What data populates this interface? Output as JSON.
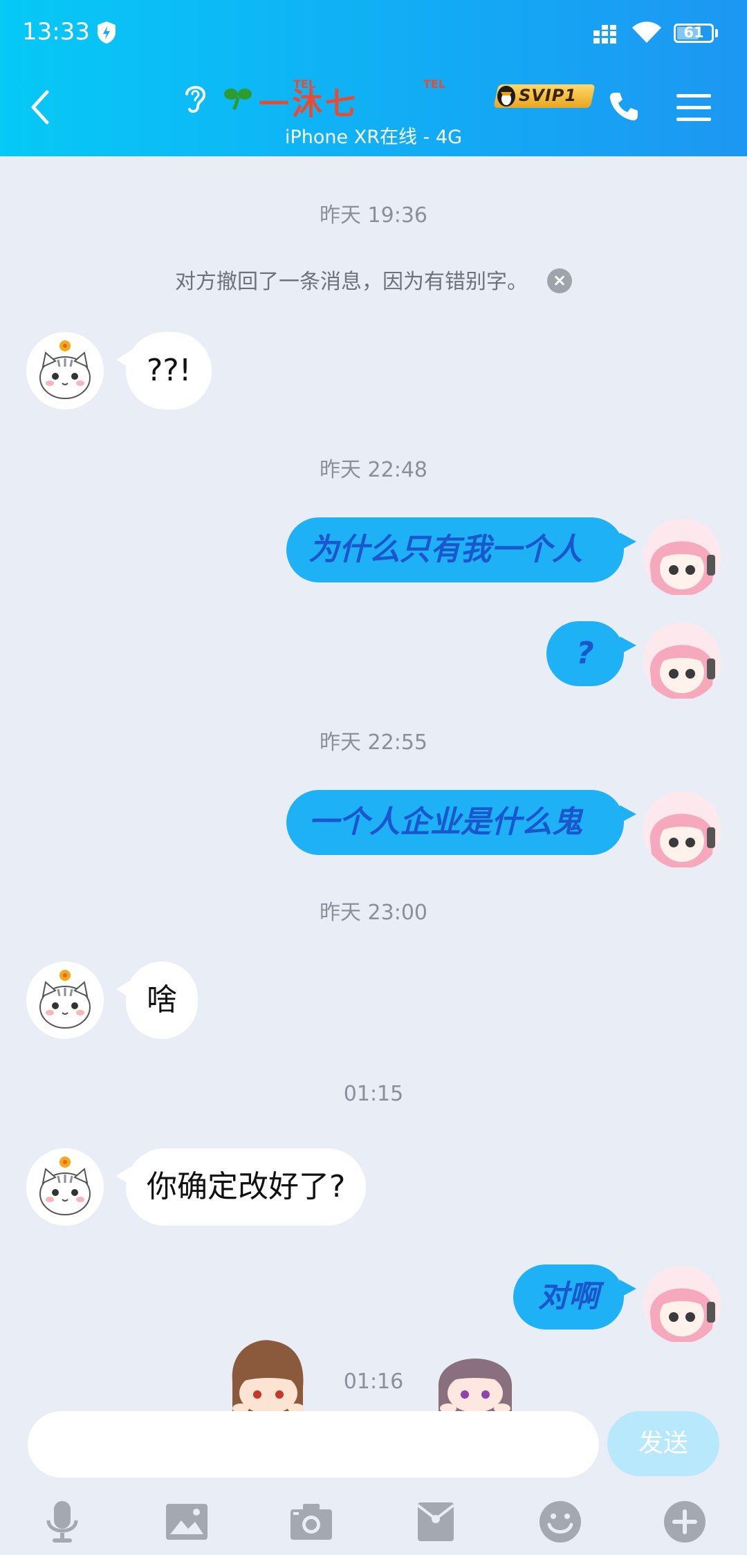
{
  "status_bar": {
    "time": "13:33",
    "battery": "61"
  },
  "header": {
    "nickname": "一沐七",
    "tel_tag": "TEL",
    "vip_badge": "SVIP1",
    "subtitle": "iPhone XR在线 - 4G"
  },
  "messages": {
    "ts1": "昨天 19:36",
    "recall_notice": "对方撤回了一条消息，因为有错别字。",
    "m1": "??!",
    "ts2": "昨天 22:48",
    "m2": "为什么只有我一个人",
    "m3": "?",
    "ts3": "昨天 22:55",
    "m4": "一个人企业是什么鬼",
    "ts4": "昨天 23:00",
    "m5": "啥",
    "ts5": "01:15",
    "m6": "你确定改好了?",
    "m7": "对啊",
    "ts6": "01:16"
  },
  "input": {
    "placeholder": "",
    "send_label": "发送"
  },
  "toolbar": [
    "mic-icon",
    "image-icon",
    "camera-icon",
    "red-packet-icon",
    "emoji-icon",
    "plus-icon"
  ],
  "colors": {
    "header_start": "#06c9f6",
    "header_end": "#1d97f2",
    "out_bubble": "#1fb1f6",
    "out_text": "#1a57cc",
    "send_button": "#b8e8fb"
  }
}
